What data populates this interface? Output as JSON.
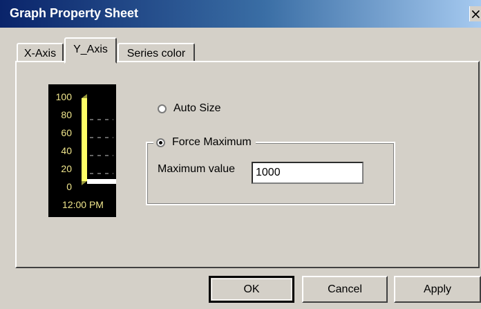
{
  "window": {
    "title": "Graph Property Sheet",
    "close_glyph": "×"
  },
  "tabs": [
    {
      "label": "X-Axis",
      "active": false
    },
    {
      "label": "Y_Axis",
      "active": true
    },
    {
      "label": "Series color",
      "active": false
    }
  ],
  "preview": {
    "y_ticks": [
      "100",
      "80",
      "60",
      "40",
      "20",
      "0"
    ],
    "x_label": "12:00 PM",
    "bar_level": 1.0,
    "colors": {
      "background": "#000000",
      "text": "#f0e68c",
      "bar": "#ffff66",
      "grid": "#c8c8c8"
    }
  },
  "options": {
    "auto_size": {
      "label": "Auto Size",
      "checked": false
    },
    "force_max": {
      "label": "Force Maximum",
      "checked": true
    }
  },
  "max_field": {
    "label": "Maximum value",
    "value": "1000"
  },
  "buttons": {
    "ok": "OK",
    "cancel": "Cancel",
    "apply": "Apply"
  },
  "icons": {
    "close": "close-icon",
    "radio": "radio-icon"
  }
}
